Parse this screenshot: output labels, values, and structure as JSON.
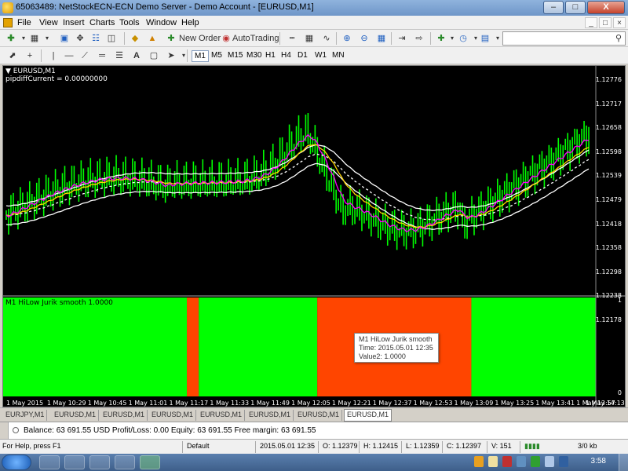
{
  "window": {
    "title": "65063489: NetStockECN-ECN Demo Server - Demo Account - [EURUSD,M1]",
    "minimize": "–",
    "maximize": "□",
    "close": "X"
  },
  "menu": [
    "File",
    "View",
    "Insert",
    "Charts",
    "Tools",
    "Window",
    "Help"
  ],
  "mdi": {
    "minimize": "_",
    "restore": "□",
    "close": "×"
  },
  "toolbar": {
    "new_order": "New Order",
    "auto_trading": "AutoTrading"
  },
  "timeframes": [
    "M1",
    "M5",
    "M15",
    "M30",
    "H1",
    "H4",
    "D1",
    "W1",
    "MN"
  ],
  "active_timeframe": "M1",
  "chart": {
    "symbol": "EURUSD,M1",
    "indicator_text": "pipdiffCurrent = 0.00000000",
    "sub_title": "M1 HiLow Jurik smooth 1.0000",
    "sub_scale_top": "1",
    "sub_scale_bottom": "0",
    "price_ticks": [
      "1.12776",
      "1.12717",
      "1.12658",
      "1.12598",
      "1.12539",
      "1.12479",
      "1.12418",
      "1.12358",
      "1.12298",
      "1.12238",
      "1.12178"
    ],
    "time_ticks": [
      "1 May 2015",
      "1 May 10:29",
      "1 May 10:45",
      "1 May 11:01",
      "1 May 11:17",
      "1 May 11:33",
      "1 May 11:49",
      "1 May 12:05",
      "1 May 12:21",
      "1 May 12:37",
      "1 May 12:53",
      "1 May 13:09",
      "1 May 13:25",
      "1 May 13:41",
      "1 May 13:57",
      "1 May 14:13"
    ],
    "colors": {
      "bull": "#00ff00",
      "bear": "#ff4500",
      "candle": "#00ff00",
      "magenta": "#ff00ff",
      "yellow": "#ffd700",
      "band": "#ffffff"
    },
    "sub_segments": [
      {
        "state": "green"
      },
      {
        "state": "red"
      },
      {
        "state": "green"
      },
      {
        "state": "red"
      },
      {
        "state": "green"
      }
    ],
    "tooltip": {
      "line1": "M1 HiLow Jurik smooth",
      "line2": "Time: 2015.05.01 12:35",
      "line3": "Value2: 1.0000"
    }
  },
  "chart_tabs": [
    "EURJPY,M1",
    "EURUSD,M1",
    "EURUSD,M1",
    "EURUSD,M1",
    "EURUSD,M1",
    "EURUSD,M1",
    "EURUSD,M1",
    "EURUSD,M1"
  ],
  "active_tab": "EURUSD,M1",
  "terminal": {
    "balance_text": "Balance: 63 691.55 USD  Profit/Loss: 0.00  Equity: 63 691.55  Free margin: 63 691.55"
  },
  "status": {
    "help": "For Help, press F1",
    "profile": "Default",
    "datetime": "2015.05.01 12:35",
    "open": "O: 1.12379",
    "high": "H: 1.12415",
    "low": "L: 1.12359",
    "close": "C: 1.12397",
    "volume": "V: 151",
    "traffic": "3/0 kb"
  },
  "taskbar": {
    "clock": "3:58"
  }
}
